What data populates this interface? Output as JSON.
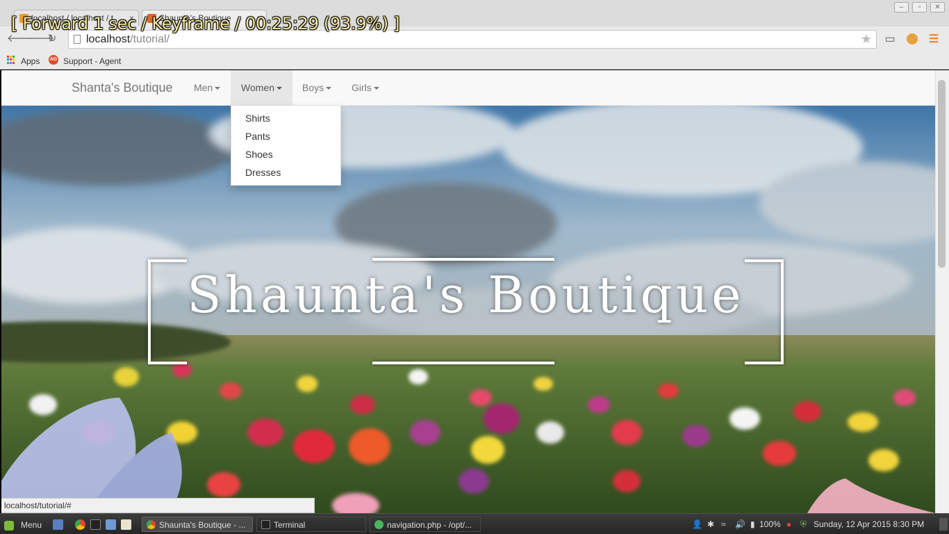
{
  "overlay": {
    "banner": "[ Forward 1 sec / Keyframe / 00:25:29 (93.9%) ]"
  },
  "browser": {
    "tabs": [
      {
        "title": "localhost / localhost / t",
        "close": "×"
      },
      {
        "title": "Shaunta's Boutique",
        "close": "×"
      }
    ],
    "address": {
      "host": "localhost",
      "path": "/tutorial/"
    },
    "bookmarks": [
      {
        "label": "Apps"
      },
      {
        "label": "Support - Agent"
      }
    ],
    "status_url": "localhost/tutorial/#"
  },
  "site": {
    "brand": "Shanta's Boutique",
    "nav": [
      {
        "label": "Men",
        "open": false
      },
      {
        "label": "Women",
        "open": true
      },
      {
        "label": "Boys",
        "open": false
      },
      {
        "label": "Girls",
        "open": false
      }
    ],
    "dropdown_items": [
      "Shirts",
      "Pants",
      "Shoes",
      "Dresses"
    ],
    "hero_title": "Shaunta's Boutique"
  },
  "taskbar": {
    "menu_label": "Menu",
    "tasks": [
      {
        "label": "Shaunta's Boutique - ...",
        "active": true
      },
      {
        "label": "Terminal",
        "active": false
      },
      {
        "label": "navigation.php - /opt/...",
        "active": false
      }
    ],
    "battery": "100%",
    "clock": "Sunday, 12 Apr 2015  8:30 PM"
  },
  "colors": {
    "navbar_bg": "#f8f8f8",
    "nav_text": "#777777",
    "nav_open_bg": "#e7e7e7",
    "hero_title": "#ffffff"
  }
}
